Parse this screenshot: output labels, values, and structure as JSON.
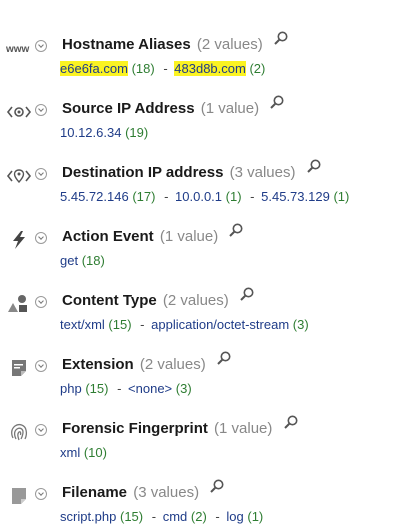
{
  "fields": [
    {
      "name": "Hostname Aliases",
      "count_label": "(2 values)",
      "icon": "www-icon",
      "values": [
        {
          "value": "e6e6fa.com",
          "count": "(18)",
          "highlight": true
        },
        {
          "value": "483d8b.com",
          "count": "(2)",
          "highlight": true
        }
      ]
    },
    {
      "name": "Source IP Address",
      "count_label": "(1 value)",
      "icon": "source-ip-icon",
      "values": [
        {
          "value": "10.12.6.34",
          "count": "(19)"
        }
      ]
    },
    {
      "name": "Destination IP address",
      "count_label": "(3 values)",
      "icon": "destination-ip-icon",
      "values": [
        {
          "value": "5.45.72.146",
          "count": "(17)"
        },
        {
          "value": "10.0.0.1",
          "count": "(1)"
        },
        {
          "value": "5.45.73.129",
          "count": "(1)"
        }
      ]
    },
    {
      "name": "Action Event",
      "count_label": "(1 value)",
      "icon": "lightning-icon",
      "values": [
        {
          "value": "get",
          "count": "(18)"
        }
      ]
    },
    {
      "name": "Content Type",
      "count_label": "(2 values)",
      "icon": "shapes-icon",
      "values": [
        {
          "value": "text/xml",
          "count": "(15)"
        },
        {
          "value": "application/octet-stream",
          "count": "(3)"
        }
      ]
    },
    {
      "name": "Extension",
      "count_label": "(2 values)",
      "icon": "file-extension-icon",
      "values": [
        {
          "value": "php",
          "count": "(15)"
        },
        {
          "value": "<none>",
          "count": "(3)"
        }
      ]
    },
    {
      "name": "Forensic Fingerprint",
      "count_label": "(1 value)",
      "icon": "fingerprint-icon",
      "values": [
        {
          "value": "xml",
          "count": "(10)"
        }
      ]
    },
    {
      "name": "Filename",
      "count_label": "(3 values)",
      "icon": "file-icon",
      "values": [
        {
          "value": "script.php",
          "count": "(15)"
        },
        {
          "value": "cmd",
          "count": "(2)"
        },
        {
          "value": "log",
          "count": "(1)"
        }
      ]
    }
  ],
  "value_separator": "-",
  "colors": {
    "highlight": "#fbf323",
    "value_link": "#1f3c88",
    "count": "#2e7d32",
    "muted": "#888888"
  }
}
